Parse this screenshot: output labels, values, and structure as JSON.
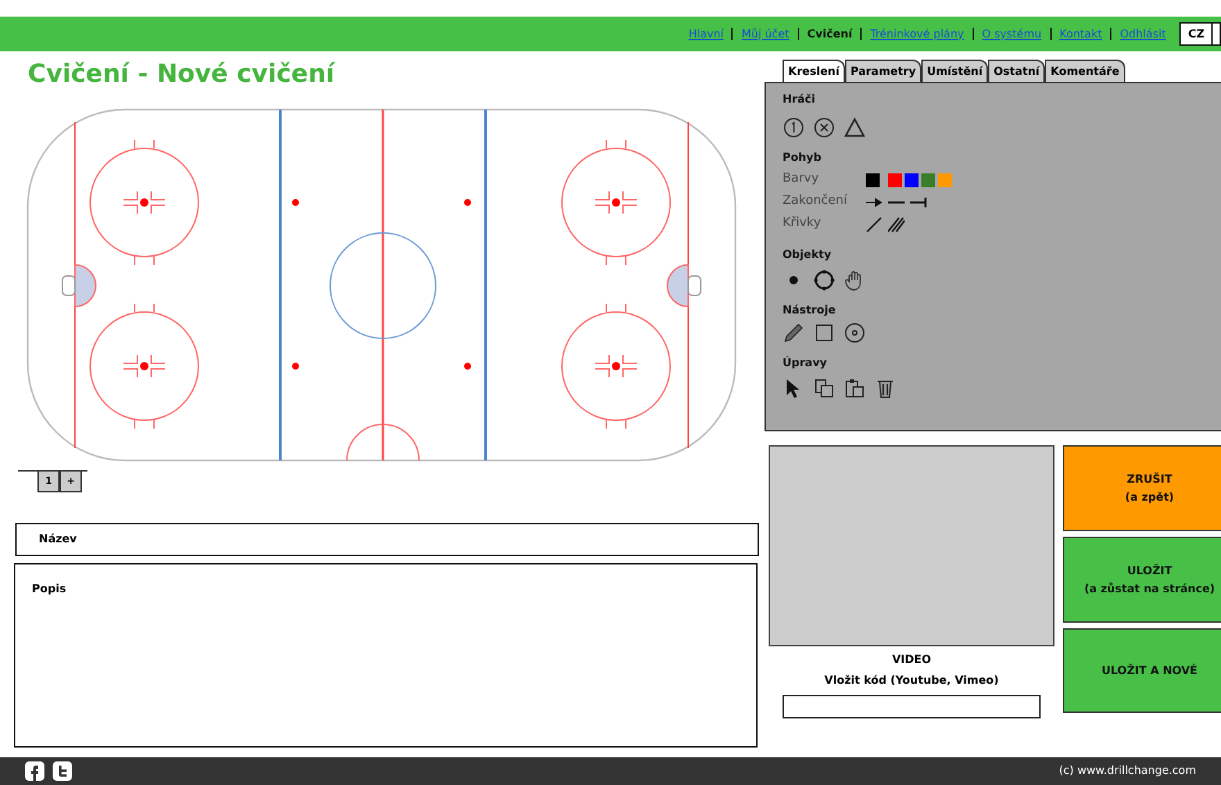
{
  "nav": {
    "links": [
      {
        "label": "Hlavní",
        "selected": false
      },
      {
        "label": "Můj účet",
        "selected": false
      },
      {
        "label": "Cvičení",
        "selected": true
      },
      {
        "label": "Tréninkové plány",
        "selected": false
      },
      {
        "label": "O systému",
        "selected": false
      },
      {
        "label": "Kontakt",
        "selected": false
      },
      {
        "label": "Odhlásit",
        "selected": false
      }
    ],
    "language": "CZ"
  },
  "title": "Cvičení - Nové cvičení",
  "tool_tabs": [
    {
      "label": "Kreslení",
      "selected": true
    },
    {
      "label": "Parametry",
      "selected": false
    },
    {
      "label": "Umístění",
      "selected": false
    },
    {
      "label": "Ostatní",
      "selected": false
    },
    {
      "label": "Komentáře",
      "selected": false
    }
  ],
  "sections": [
    {
      "kind": "players",
      "title": "Hráči"
    },
    {
      "kind": "movement",
      "title": "Pohyb",
      "rows": [
        {
          "kind": "colors",
          "label": "Barvy",
          "colors": [
            {
              "color": "#000000"
            },
            {
              "color": "#ff0000"
            },
            {
              "color": "#0000ff"
            },
            {
              "color": "#3a7d2a"
            },
            {
              "color": "#ff9900"
            }
          ]
        },
        {
          "kind": "endings",
          "label": "Zakončení"
        },
        {
          "kind": "curves",
          "label": "Křivky"
        }
      ]
    },
    {
      "kind": "objects",
      "title": "Objekty"
    },
    {
      "kind": "tools",
      "title": "Nástroje"
    },
    {
      "kind": "edits",
      "title": "Úpravy"
    }
  ],
  "page_tabs": [
    "1",
    "+"
  ],
  "name_field": {
    "placeholder": "Název"
  },
  "description_field": {
    "placeholder": "Popis"
  },
  "video": {
    "title": "VIDEO",
    "hint": "Vložit kód (Youtube, Vimeo)"
  },
  "buttons": [
    {
      "kind": "cancel",
      "title": "ZRUŠIT",
      "subtitle": "(a zpět)"
    },
    {
      "kind": "save",
      "title": "ULOŽIT",
      "subtitle": "(a zůstat na stránce)"
    },
    {
      "kind": "save",
      "title": "ULOŽIT A NOVÉ"
    }
  ],
  "footer": {
    "copyright": "(c) www.drillchange.com"
  }
}
